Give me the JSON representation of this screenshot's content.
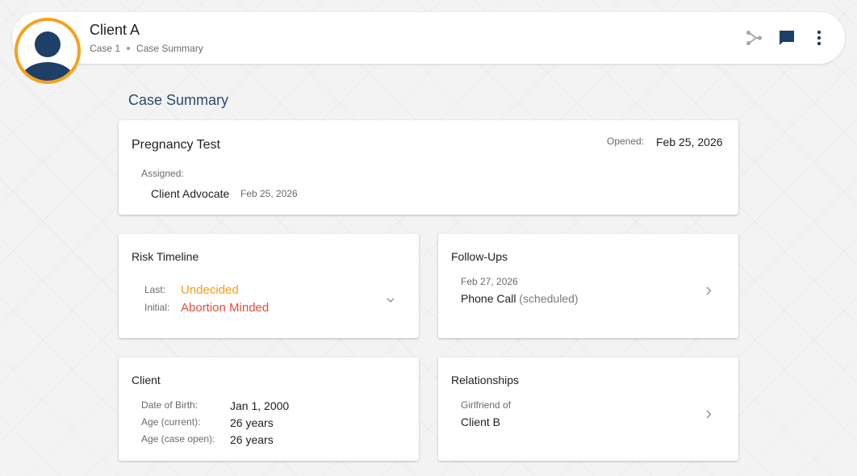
{
  "header": {
    "title": "Client A",
    "breadcrumb": [
      "Case 1",
      "Case Summary"
    ],
    "icons": [
      "share-icon",
      "chat-icon",
      "more-vertical-icon"
    ]
  },
  "colors": {
    "accent": "#f5a21b",
    "navy": "#1e3f66",
    "undecided": "#f39c12",
    "abortion_minded": "#e74c3c"
  },
  "section_title": "Case Summary",
  "summary": {
    "title": "Pregnancy Test",
    "opened_label": "Opened:",
    "opened_value": "Feb 25, 2026",
    "assigned_label": "Assigned:",
    "assignee": "Client Advocate",
    "assigned_date": "Feb 25, 2026"
  },
  "risk": {
    "title": "Risk Timeline",
    "last_label": "Last:",
    "last_value": "Undecided",
    "initial_label": "Initial:",
    "initial_value": "Abortion Minded"
  },
  "followups": {
    "title": "Follow-Ups",
    "date": "Feb 27, 2026",
    "type": "Phone Call",
    "status": "(scheduled)"
  },
  "client": {
    "title": "Client",
    "dob_label": "Date of Birth:",
    "dob_value": "Jan 1, 2000",
    "age_current_label": "Age (current):",
    "age_current_value": "26 years",
    "age_open_label": "Age (case open):",
    "age_open_value": "26 years"
  },
  "relationships": {
    "title": "Relationships",
    "relation": "Girlfriend of",
    "person": "Client B"
  }
}
